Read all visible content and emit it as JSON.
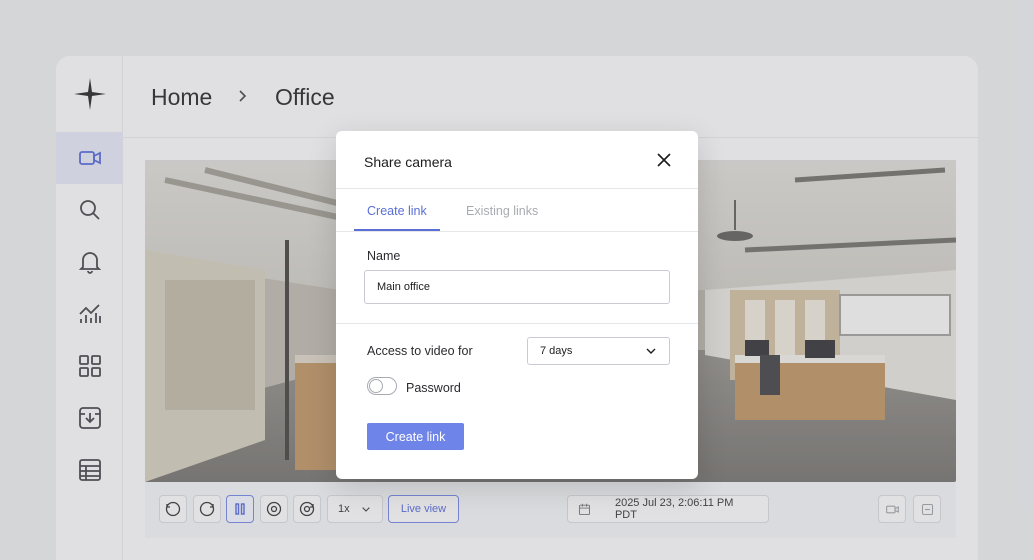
{
  "breadcrumb": {
    "home": "Home",
    "current": "Office"
  },
  "sidebar": {
    "items": [
      {
        "name": "camera-icon",
        "active": true
      },
      {
        "name": "search-icon",
        "active": false
      },
      {
        "name": "bell-icon",
        "active": false
      },
      {
        "name": "analytics-icon",
        "active": false
      },
      {
        "name": "grid-icon",
        "active": false
      },
      {
        "name": "archive-download-icon",
        "active": false
      },
      {
        "name": "table-icon",
        "active": false
      }
    ]
  },
  "controls": {
    "speed": "1x",
    "live_view": "Live view",
    "timestamp": "2025 Jul 23, 2:06:11 PM PDT"
  },
  "modal": {
    "title": "Share camera",
    "tabs": [
      {
        "label": "Create link",
        "active": true
      },
      {
        "label": "Existing links",
        "active": false
      }
    ],
    "name_label": "Name",
    "name_value": "Main office",
    "access_label": "Access to video for",
    "access_value": "7 days",
    "password_label": "Password",
    "password_enabled": false,
    "submit_label": "Create link"
  },
  "colors": {
    "accent": "#5b6fd6",
    "button": "#6f84e8",
    "active_nav": "#dfe3f1"
  }
}
